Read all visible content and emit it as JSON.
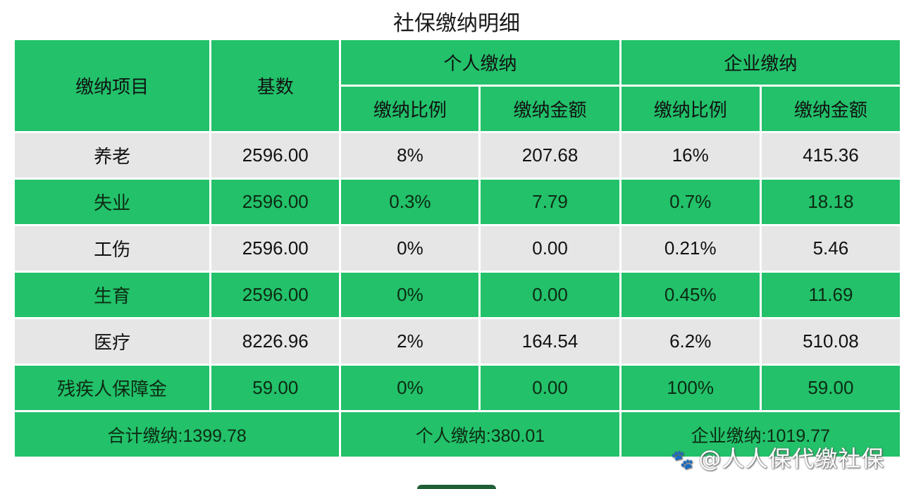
{
  "title": "社保缴纳明细",
  "header": {
    "item": "缴纳项目",
    "base": "基数",
    "personal_group": "个人缴纳",
    "company_group": "企业缴纳",
    "personal_rate": "缴纳比例",
    "personal_amount": "缴纳金额",
    "company_rate": "缴纳比例",
    "company_amount": "缴纳金额"
  },
  "rows": [
    {
      "name": "养老",
      "base": "2596.00",
      "p_rate": "8%",
      "p_amount": "207.68",
      "c_rate": "16%",
      "c_amount": "415.36"
    },
    {
      "name": "失业",
      "base": "2596.00",
      "p_rate": "0.3%",
      "p_amount": "7.79",
      "c_rate": "0.7%",
      "c_amount": "18.18"
    },
    {
      "name": "工伤",
      "base": "2596.00",
      "p_rate": "0%",
      "p_amount": "0.00",
      "c_rate": "0.21%",
      "c_amount": "5.46"
    },
    {
      "name": "生育",
      "base": "2596.00",
      "p_rate": "0%",
      "p_amount": "0.00",
      "c_rate": "0.45%",
      "c_amount": "11.69"
    },
    {
      "name": "医疗",
      "base": "8226.96",
      "p_rate": "2%",
      "p_amount": "164.54",
      "c_rate": "6.2%",
      "c_amount": "510.08"
    },
    {
      "name": "残疾人保障金",
      "base": "59.00",
      "p_rate": "0%",
      "p_amount": "0.00",
      "c_rate": "100%",
      "c_amount": "59.00"
    }
  ],
  "footer": {
    "total": "合计缴纳:1399.78",
    "personal_total": "个人缴纳:380.01",
    "company_total": "企业缴纳:1019.77"
  },
  "watermark": {
    "icon": "baidu-paw-icon",
    "text": "@人人保代缴社保"
  },
  "colors": {
    "green": "#22c16a",
    "gray": "#e6e6e6"
  }
}
